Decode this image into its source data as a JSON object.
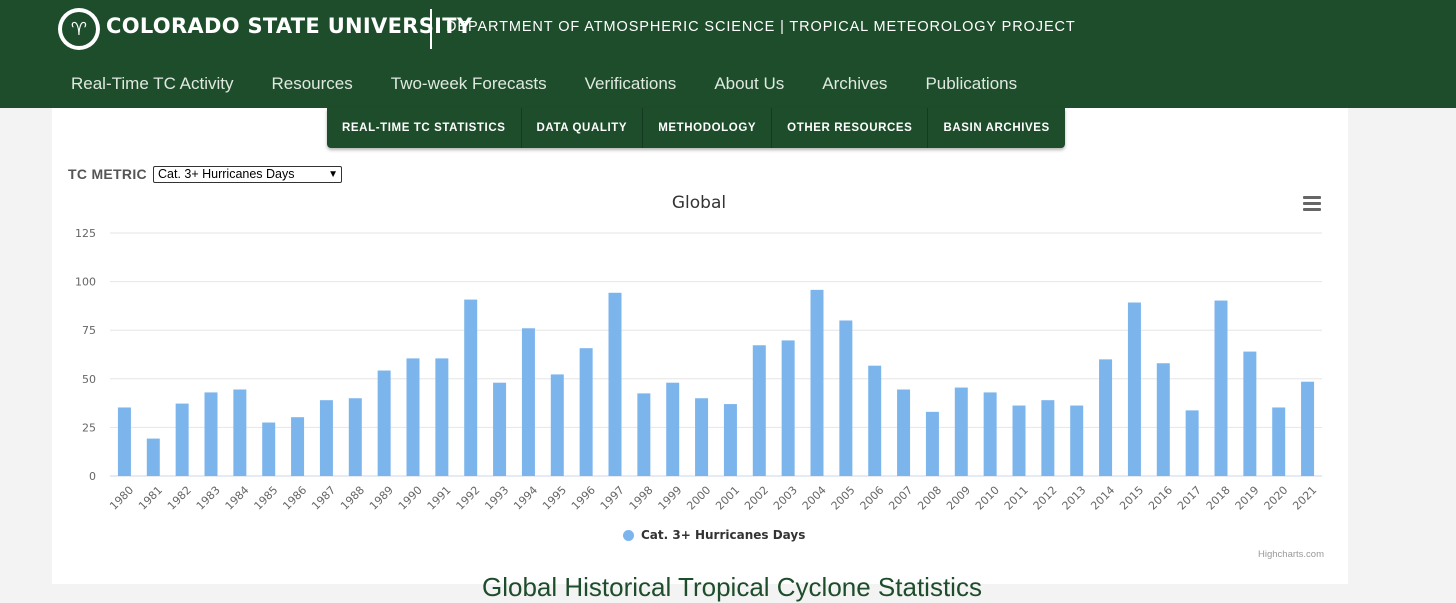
{
  "header": {
    "logo_icon": "ram-icon",
    "university": "COLORADO STATE UNIVERSITY",
    "department": "DEPARTMENT OF ATMOSPHERIC SCIENCE | TROPICAL METEOROLOGY PROJECT"
  },
  "nav": {
    "items": [
      "Real-Time TC Activity",
      "Resources",
      "Two-week Forecasts",
      "Verifications",
      "About Us",
      "Archives",
      "Publications"
    ]
  },
  "subnav": {
    "items": [
      "REAL-TIME TC STATISTICS",
      "DATA QUALITY",
      "METHODOLOGY",
      "OTHER RESOURCES",
      "BASIN ARCHIVES"
    ]
  },
  "metric": {
    "label": "TC METRIC",
    "selected": "Cat. 3+ Hurricanes Days"
  },
  "colors": {
    "brand_green": "#1e4d2b",
    "bar": "#7cb5ec"
  },
  "chart_data": {
    "type": "bar",
    "title": "Global",
    "xlabel": "",
    "ylabel": "",
    "ylim": [
      0,
      125
    ],
    "yticks": [
      0,
      25,
      50,
      75,
      100,
      125
    ],
    "grid": true,
    "legend_position": "bottom-center",
    "categories": [
      "1980",
      "1981",
      "1982",
      "1983",
      "1984",
      "1985",
      "1986",
      "1987",
      "1988",
      "1989",
      "1990",
      "1991",
      "1992",
      "1993",
      "1994",
      "1995",
      "1996",
      "1997",
      "1998",
      "1999",
      "2000",
      "2001",
      "2002",
      "2003",
      "2004",
      "2005",
      "2006",
      "2007",
      "2008",
      "2009",
      "2010",
      "2011",
      "2012",
      "2013",
      "2014",
      "2015",
      "2016",
      "2017",
      "2018",
      "2019",
      "2020",
      "2021"
    ],
    "series": [
      {
        "name": "Cat. 3+ Hurricanes Days",
        "color": "#7cb5ec",
        "values": [
          35.25,
          19.25,
          37.25,
          43.0,
          44.5,
          27.5,
          30.25,
          39.0,
          40.0,
          54.25,
          60.5,
          60.5,
          90.75,
          48.0,
          76.0,
          52.25,
          65.75,
          94.25,
          42.5,
          48.0,
          40.0,
          37.0,
          67.25,
          69.75,
          95.75,
          80.0,
          56.75,
          44.5,
          33.0,
          45.5,
          43.0,
          36.25,
          39.0,
          36.25,
          60.0,
          89.25,
          58.0,
          33.75,
          90.25,
          64.0,
          35.25,
          48.5
        ]
      }
    ],
    "credit": "Highcharts.com"
  },
  "footer": {
    "heading": "Global Historical Tropical Cyclone Statistics"
  }
}
